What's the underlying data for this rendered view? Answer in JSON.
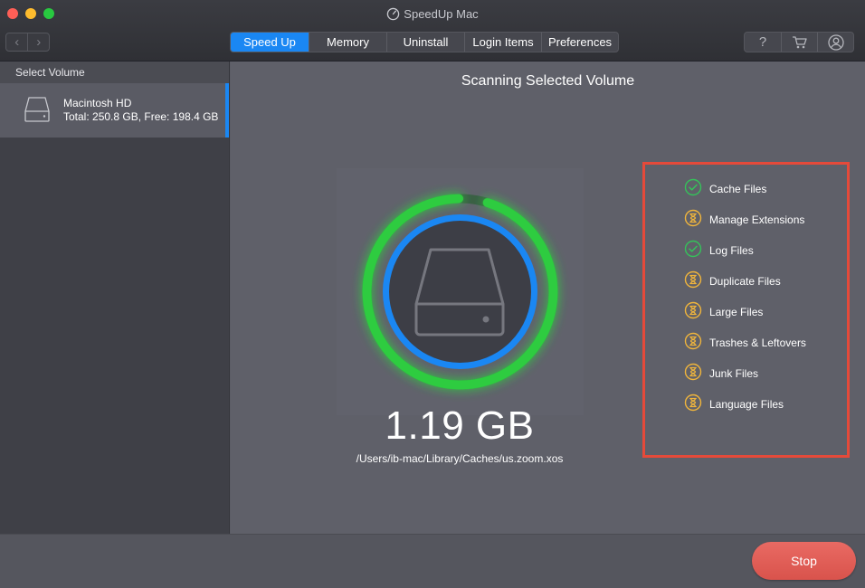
{
  "window": {
    "title": "SpeedUp Mac"
  },
  "nav": {
    "back_label": "‹",
    "forward_label": "›"
  },
  "tabs": [
    {
      "label": "Speed Up",
      "active": true
    },
    {
      "label": "Memory",
      "active": false
    },
    {
      "label": "Uninstall",
      "active": false
    },
    {
      "label": "Login Items",
      "active": false
    },
    {
      "label": "Preferences",
      "active": false
    }
  ],
  "tools": {
    "help_label": "?",
    "cart_icon": "cart-icon",
    "account_icon": "user-icon"
  },
  "sidebar": {
    "header": "Select Volume",
    "volume": {
      "name": "Macintosh HD",
      "info": "Total: 250.8 GB, Free: 198.4 GB",
      "icon": "hard-drive-icon"
    }
  },
  "main": {
    "title": "Scanning Selected Volume",
    "size": "1.19 GB",
    "path": "/Users/ib-mac/Library/Caches/us.zoom.xos",
    "scan_progress": 0.95
  },
  "checklist": [
    {
      "label": "Cache Files",
      "status": "done"
    },
    {
      "label": "Manage Extensions",
      "status": "pending"
    },
    {
      "label": "Log Files",
      "status": "done"
    },
    {
      "label": "Duplicate Files",
      "status": "pending"
    },
    {
      "label": "Large Files",
      "status": "pending"
    },
    {
      "label": "Trashes & Leftovers",
      "status": "pending"
    },
    {
      "label": "Junk Files",
      "status": "pending"
    },
    {
      "label": "Language Files",
      "status": "pending"
    }
  ],
  "bottom": {
    "stop_label": "Stop"
  },
  "colors": {
    "accent_blue": "#1a87f3",
    "ring_green": "#2ecc40",
    "done_green": "#35c25a",
    "pending_orange": "#f0b53c",
    "stop_red": "#e0564e",
    "highlight_red": "#e54a3a"
  }
}
